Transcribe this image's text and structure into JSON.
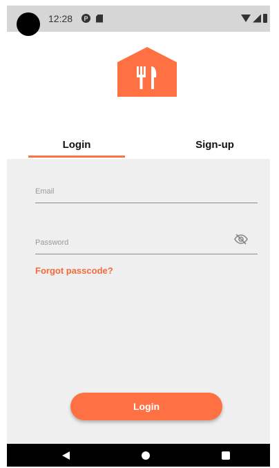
{
  "status_bar": {
    "time": "12:28",
    "left_icons": [
      "p-notification-icon",
      "sd-card-icon"
    ],
    "right_icons": [
      "wifi-icon",
      "signal-icon",
      "battery-icon"
    ]
  },
  "logo": {
    "icon": "fork-knife-house-icon",
    "color": "#ff7043"
  },
  "tabs": [
    {
      "label": "Login",
      "active": true
    },
    {
      "label": "Sign-up",
      "active": false
    }
  ],
  "form": {
    "email": {
      "placeholder": "Email",
      "value": ""
    },
    "password": {
      "placeholder": "Password",
      "value": ""
    },
    "forgot_label": "Forgot passcode?",
    "submit_label": "Login"
  },
  "colors": {
    "accent": "#ff7043",
    "link": "#f26b3a",
    "form_bg": "#efefef",
    "status_bar_bg": "#d6d6d6"
  },
  "nav_bar": {
    "buttons": [
      "back-icon",
      "home-icon",
      "recents-icon"
    ]
  }
}
